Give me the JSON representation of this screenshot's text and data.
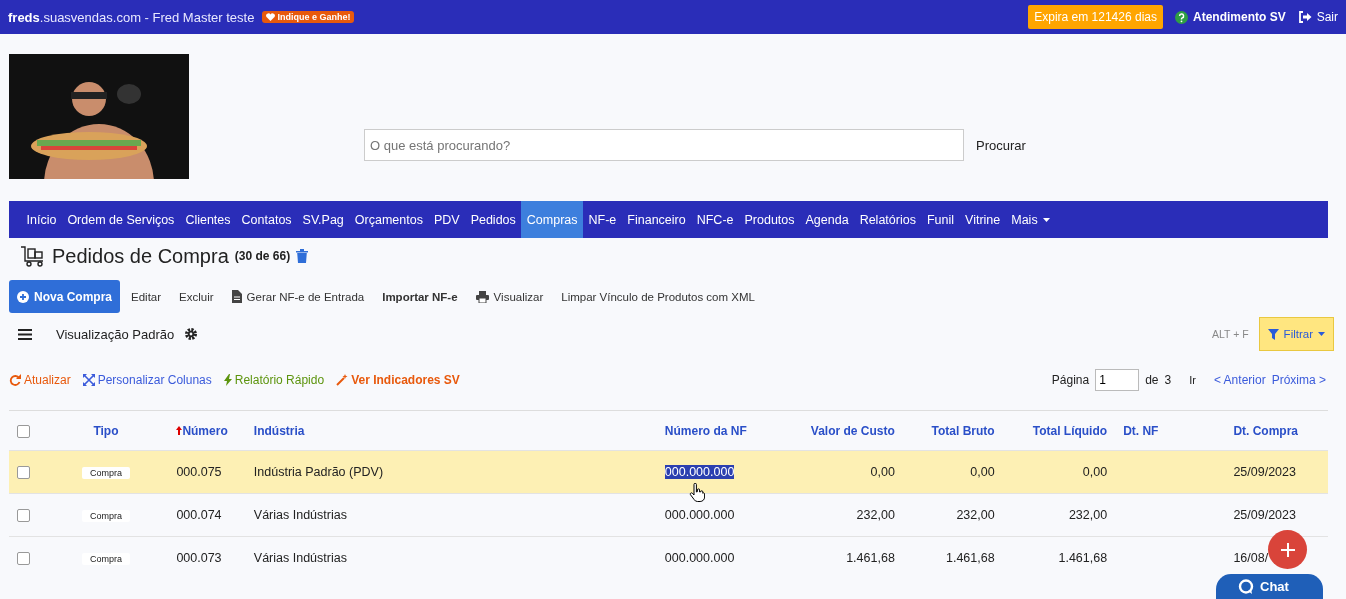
{
  "top_bar": {
    "site_bold": "freds",
    "site_rest": ".suasvendas.com - Fred Master teste",
    "promo_badge": "Indique e Ganhe!",
    "expiry_badge": "Expira em 121426 dias",
    "support_link": "Atendimento SV",
    "logout_link": "Sair"
  },
  "search": {
    "placeholder": "O que está procurando?",
    "button": "Procurar"
  },
  "nav": [
    {
      "label": "Início",
      "selected": false
    },
    {
      "label": "Ordem de Serviços",
      "selected": false
    },
    {
      "label": "Clientes",
      "selected": false
    },
    {
      "label": "Contatos",
      "selected": false
    },
    {
      "label": "SV.Pag",
      "selected": false
    },
    {
      "label": "Orçamentos",
      "selected": false
    },
    {
      "label": "PDV",
      "selected": false
    },
    {
      "label": "Pedidos",
      "selected": false
    },
    {
      "label": "Compras",
      "selected": true
    },
    {
      "label": "NF-e",
      "selected": false
    },
    {
      "label": "Financeiro",
      "selected": false
    },
    {
      "label": "NFC-e",
      "selected": false
    },
    {
      "label": "Produtos",
      "selected": false
    },
    {
      "label": "Agenda",
      "selected": false
    },
    {
      "label": "Relatórios",
      "selected": false
    },
    {
      "label": "Funil",
      "selected": false
    },
    {
      "label": "Vitrine",
      "selected": false
    },
    {
      "label": "Mais",
      "selected": false,
      "dropdown": true
    }
  ],
  "page": {
    "title": "Pedidos de Compra",
    "count": "(30 de 66)"
  },
  "toolbar": [
    {
      "kind": "primary",
      "label": "Nova Compra"
    },
    {
      "kind": "plain",
      "label": "Editar"
    },
    {
      "kind": "plain",
      "label": "Excluir"
    },
    {
      "kind": "file",
      "label": "Gerar NF-e de Entrada"
    },
    {
      "kind": "bold",
      "label": "Importar NF-e"
    },
    {
      "kind": "print",
      "label": "Visualizar"
    },
    {
      "kind": "plain",
      "label": "Limpar Vínculo de Produtos com XML"
    }
  ],
  "view": {
    "label": "Visualização Padrão",
    "shortcut": "ALT + F",
    "filter_button": "Filtrar"
  },
  "actions": [
    {
      "kind": "refresh",
      "label": "Atualizar",
      "color": "#e8590c"
    },
    {
      "kind": "columns",
      "label": "Personalizar Colunas",
      "color": "#3b5bdb"
    },
    {
      "kind": "bolt",
      "label": "Relatório Rápido",
      "color": "#5c940d"
    },
    {
      "kind": "wand",
      "label": "Ver Indicadores SV",
      "color": "#e8590c"
    }
  ],
  "pagination": {
    "page_label": "Página",
    "page_value": "1",
    "of_label": "de",
    "total": "3",
    "go": "Ir",
    "previous": "< Anterior",
    "next": "Próxima >"
  },
  "table": {
    "select_all_checked": false,
    "columns": [
      {
        "label": "Tipo",
        "sorted": false
      },
      {
        "label": "Número",
        "sorted": true
      },
      {
        "label": "Indústria",
        "sorted": false
      },
      {
        "label": "Número da NF",
        "sorted": false
      },
      {
        "label": "Valor de Custo",
        "sorted": false
      },
      {
        "label": "Total Bruto",
        "sorted": false
      },
      {
        "label": "Total Líquido",
        "sorted": false
      },
      {
        "label": "Dt. NF",
        "sorted": false
      },
      {
        "label": "Dt. Compra",
        "sorted": false
      }
    ],
    "rows": [
      {
        "selected": true,
        "checked": false,
        "nf_highlighted": true,
        "cells": [
          "Compra",
          "000.075",
          "Indústria Padrão (PDV)",
          "000.000.000",
          "0,00",
          "0,00",
          "0,00",
          "",
          "25/09/2023"
        ]
      },
      {
        "selected": false,
        "checked": false,
        "nf_highlighted": false,
        "cells": [
          "Compra",
          "000.074",
          "Várias Indústrias",
          "000.000.000",
          "232,00",
          "232,00",
          "232,00",
          "",
          "25/09/2023"
        ]
      },
      {
        "selected": false,
        "checked": false,
        "nf_highlighted": false,
        "cells": [
          "Compra",
          "000.073",
          "Várias Indústrias",
          "000.000.000",
          "1.461,68",
          "1.461,68",
          "1.461,68",
          "",
          "16/08/"
        ]
      }
    ]
  },
  "chat_button": "Chat"
}
